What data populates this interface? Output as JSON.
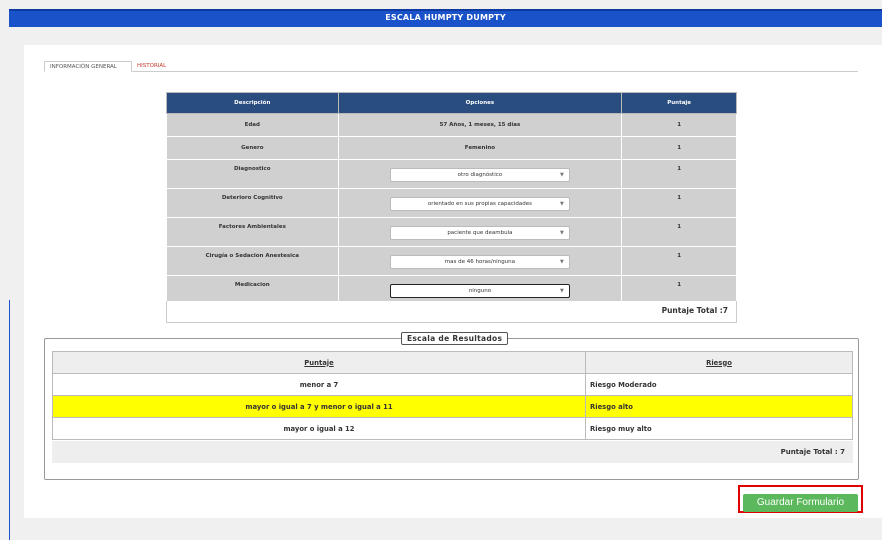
{
  "header": {
    "title": "ESCALA HUMPTY DUMPTY"
  },
  "tabs": [
    {
      "label": "INFORMACIÓN GENERAL",
      "active": true
    },
    {
      "label": "HISTORIAL",
      "active": false
    }
  ],
  "main_table": {
    "headers": [
      "Descripción",
      "Opciones",
      "Puntaje"
    ],
    "rows": [
      {
        "desc": "Edad",
        "option": "57 Años, 1 meses, 15 días",
        "score": "1"
      },
      {
        "desc": "Genero",
        "option": "Femenino",
        "score": "1"
      },
      {
        "desc": "Diagnostico",
        "option": "otro diagnóstico",
        "score": "1"
      },
      {
        "desc": "Deterioro Cognitivo",
        "option": "orientado en sus propias capacidades",
        "score": "1"
      },
      {
        "desc": "Factores Ambientales",
        "option": "paciente que deambula",
        "score": "1"
      },
      {
        "desc": "Cirugía o Sedacion Anestesica",
        "option": "mas de 46 horas/ninguna",
        "score": "1"
      },
      {
        "desc": "Medicacion",
        "option": "ninguno",
        "score": "1"
      }
    ],
    "total": "Puntaje Total :7"
  },
  "results": {
    "legend": "Escala de Resultados",
    "headers": [
      "Puntaje",
      "Riesgo"
    ],
    "rows": [
      {
        "puntaje": "menor a 7",
        "riesgo": "Riesgo Moderado",
        "highlight": false
      },
      {
        "puntaje": "mayor o igual a 7 y menor o igual a 11",
        "riesgo": "Riesgo alto",
        "highlight": true
      },
      {
        "puntaje": "mayor o igual a 12",
        "riesgo": "Riesgo muy alto",
        "highlight": false
      }
    ],
    "total": "Puntaje Total : 7",
    "highlight_color": "#ffff00"
  },
  "actions": {
    "save_label": "Guardar Formulario",
    "save_color": "#5cb85c"
  },
  "colors": {
    "header_blue": "#1a52c9",
    "table_header": "#2a4d80"
  }
}
